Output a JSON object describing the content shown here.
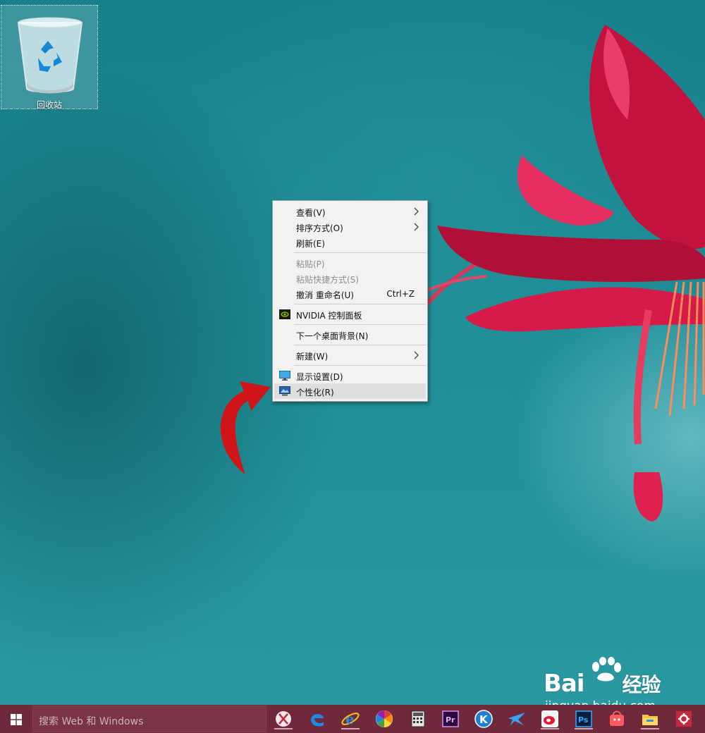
{
  "desktop": {
    "recycle_bin_label": "回收站"
  },
  "context_menu": {
    "items": [
      {
        "label": "查看(V)",
        "submenu": true,
        "disabled": false
      },
      {
        "label": "排序方式(O)",
        "submenu": true,
        "disabled": false
      },
      {
        "label": "刷新(E)",
        "submenu": false,
        "disabled": false
      },
      {
        "label": "粘贴(P)",
        "submenu": false,
        "disabled": true
      },
      {
        "label": "粘贴快捷方式(S)",
        "submenu": false,
        "disabled": true
      },
      {
        "label": "撤消 重命名(U)",
        "shortcut": "Ctrl+Z",
        "submenu": false,
        "disabled": false
      },
      {
        "label": "NVIDIA 控制面板",
        "icon": "nvidia-icon",
        "submenu": false,
        "disabled": false
      },
      {
        "label": "下一个桌面背景(N)",
        "submenu": false,
        "disabled": false
      },
      {
        "label": "新建(W)",
        "submenu": true,
        "disabled": false
      },
      {
        "label": "显示设置(D)",
        "icon": "display-icon",
        "submenu": false,
        "disabled": false
      },
      {
        "label": "个性化(R)",
        "icon": "personalize-icon",
        "submenu": false,
        "disabled": false,
        "highlighted": true
      }
    ]
  },
  "taskbar": {
    "search_placeholder": "搜索 Web 和 Windows",
    "pinned": [
      "snipping-tool-icon",
      "edge-icon",
      "ie-icon",
      "photo-icon",
      "calculator-icon",
      "premiere-icon",
      "kugou-icon",
      "feiyu-icon",
      "weibo-icon",
      "photoshop-icon",
      "qq-app-icon",
      "file-explorer-icon",
      "settings-icon"
    ],
    "color": "#6e2a3b"
  },
  "watermark": {
    "brand": "Bai",
    "brand_cn": "经验",
    "url": "jingyan.baidu.com"
  },
  "colors": {
    "accent_red": "#d0151a",
    "menu_bg": "#f2f2f2"
  }
}
